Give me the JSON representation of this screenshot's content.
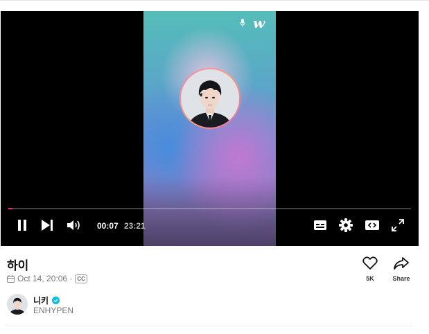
{
  "player": {
    "brand_logo": "w",
    "progress_fraction": 0.01,
    "time_current": "00:07",
    "time_duration": "23:21",
    "accent_color": "#ff2a55",
    "icons": [
      "pause-icon",
      "skip-next-icon",
      "volume-icon",
      "captions-icon",
      "settings-icon",
      "theater-mode-icon",
      "fullscreen-icon",
      "mic-icon"
    ]
  },
  "video": {
    "title": "하이",
    "date": "Oct 14, 20:06 ·",
    "cc_badge": "CC"
  },
  "actions": {
    "like_count": "5K",
    "share_label": "Share"
  },
  "author": {
    "name": "니키",
    "group": "ENHYPEN",
    "verified_color": "#00c2e0"
  }
}
